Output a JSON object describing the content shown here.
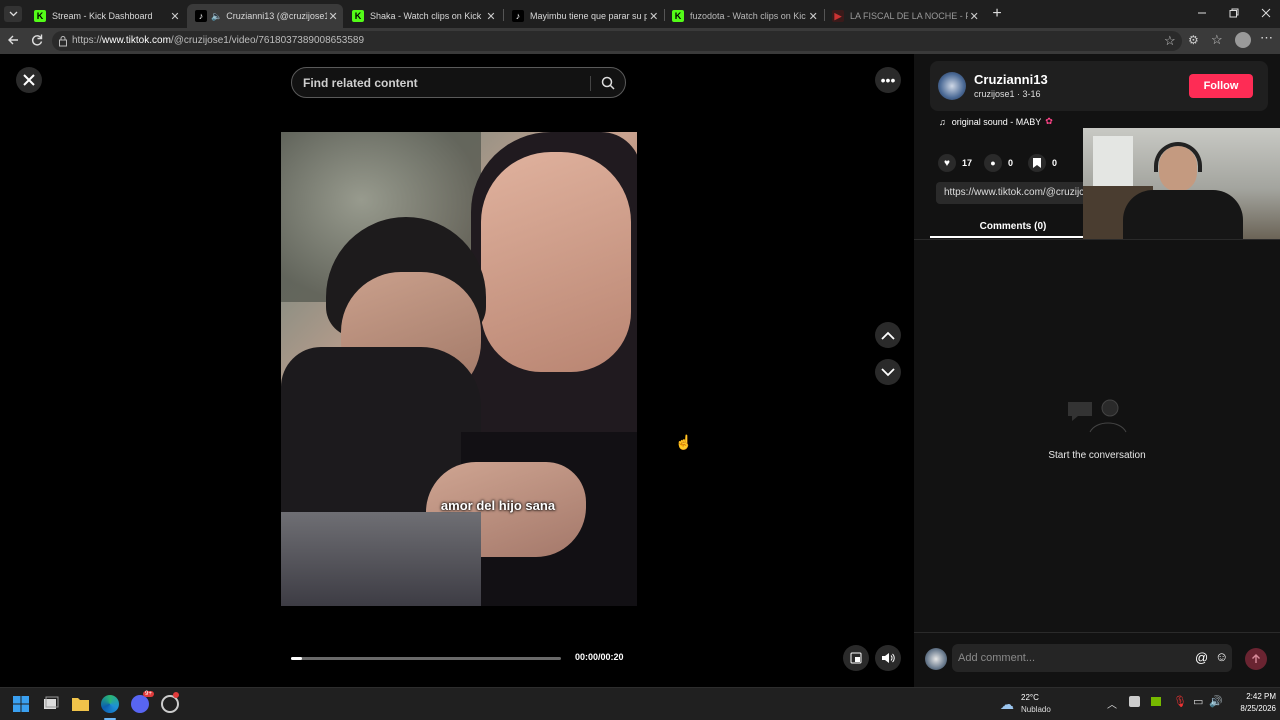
{
  "browser": {
    "tabs": [
      {
        "title": "Stream - Kick Dashboard",
        "favicon": "kick-icon",
        "active": false
      },
      {
        "title": "Cruzianni13 (@cruzijose1) | Ti",
        "favicon": "tiktok-icon",
        "active": true
      },
      {
        "title": "Shaka - Watch clips on Kick",
        "favicon": "kick-icon",
        "active": false
      },
      {
        "title": "Mayimbu tiene que parar su pleit",
        "favicon": "tiktok-icon",
        "active": false
      },
      {
        "title": "fuzodota - Watch clips on Kick",
        "favicon": "kick-icon",
        "active": false
      },
      {
        "title": "LA FISCAL DE LA NOCHE - PIURA",
        "favicon": "youtube-icon",
        "active": false
      }
    ],
    "url_prefix": "https://",
    "url_host": "www.tiktok.com",
    "url_path": "/@cruzijose1/video/7618037389008653589"
  },
  "player": {
    "search_placeholder": "Find related content",
    "caption": "amor del hijo sana",
    "time": "00:00/00:20",
    "progress": 0.04
  },
  "sidebar": {
    "display_name": "Cruzianni13",
    "username": "cruzijose1",
    "date": "3-16",
    "follow_label": "Follow",
    "sound": "original sound - MABY",
    "likes": "17",
    "comments": "0",
    "saves": "0",
    "share_link": "https://www.tiktok.com/@cruzijc",
    "comments_tab": "Comments (0)",
    "empty_state": "Start the conversation",
    "comment_placeholder": "Add comment..."
  },
  "taskbar": {
    "temperature": "22°C",
    "weather": "Nublado",
    "time": "2:42 PM",
    "date": "8/25/2026",
    "discord_badge": "9+"
  },
  "colors": {
    "accent": "#fe2c55",
    "kick_green": "#53fc18"
  }
}
